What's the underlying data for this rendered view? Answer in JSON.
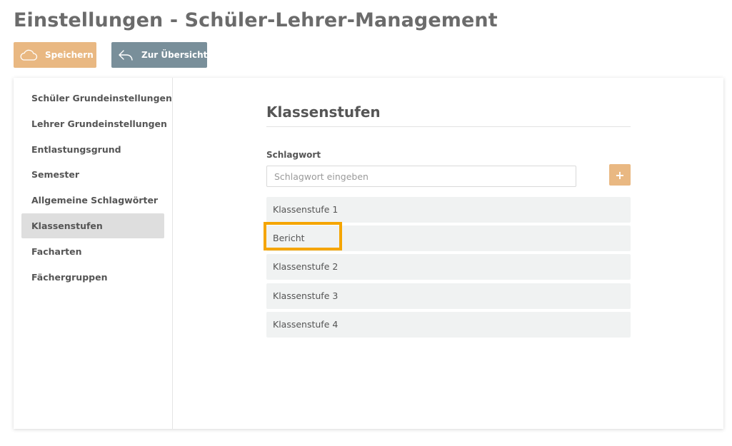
{
  "header": {
    "title": "Einstellungen - Schüler-Lehrer-Management"
  },
  "toolbar": {
    "save_label": "Speichern",
    "save_icon": "cloud-icon",
    "back_label": "Zur Übersicht",
    "back_icon": "reply-arrow-icon"
  },
  "sidebar": {
    "active_index": 5,
    "items": [
      {
        "label": "Schüler Grundeinstellungen"
      },
      {
        "label": "Lehrer Grundeinstellungen"
      },
      {
        "label": "Entlastungsgrund"
      },
      {
        "label": "Semester"
      },
      {
        "label": "Allgemeine Schlagwörter"
      },
      {
        "label": "Klassenstufen"
      },
      {
        "label": "Facharten"
      },
      {
        "label": "Fächergruppen"
      }
    ]
  },
  "content": {
    "title": "Klassenstufen",
    "field_label": "Schlagwort",
    "input_placeholder": "Schlagwort eingeben",
    "input_value": "",
    "add_button_symbol": "+",
    "items": [
      {
        "label": "Klassenstufe 1"
      },
      {
        "label": "Bericht"
      },
      {
        "label": "Klassenstufe 2"
      },
      {
        "label": "Klassenstufe 3"
      },
      {
        "label": "Klassenstufe 4"
      }
    ]
  },
  "colors": {
    "accent": "#e9b882",
    "secondary": "#798f9a",
    "active_item_bg": "#dedede",
    "list_item_bg": "#f0f2f2",
    "highlight_border": "#f5a500"
  }
}
